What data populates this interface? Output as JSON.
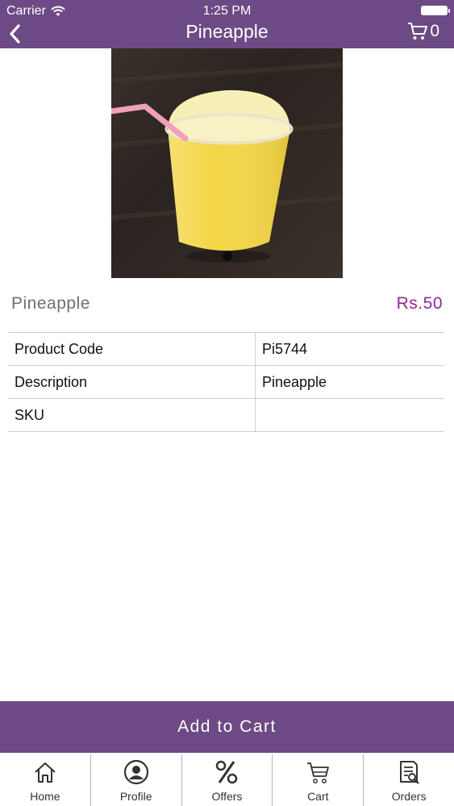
{
  "status_bar": {
    "carrier": "Carrier",
    "time": "1:25 PM"
  },
  "nav": {
    "title": "Pineapple",
    "cart_count": "0"
  },
  "product": {
    "name": "Pineapple",
    "price": "Rs.50"
  },
  "details": [
    {
      "key": "Product Code",
      "value": "Pi5744"
    },
    {
      "key": "Description",
      "value": "Pineapple"
    },
    {
      "key": "SKU",
      "value": ""
    }
  ],
  "add_to_cart_label": "Add to Cart",
  "tabs": [
    {
      "label": "Home",
      "icon": "home-icon"
    },
    {
      "label": "Profile",
      "icon": "profile-icon"
    },
    {
      "label": "Offers",
      "icon": "offers-icon"
    },
    {
      "label": "Cart",
      "icon": "cart-icon"
    },
    {
      "label": "Orders",
      "icon": "orders-icon"
    }
  ],
  "colors": {
    "brand_purple": "#6d4a85",
    "price_color": "#8e2a98"
  }
}
